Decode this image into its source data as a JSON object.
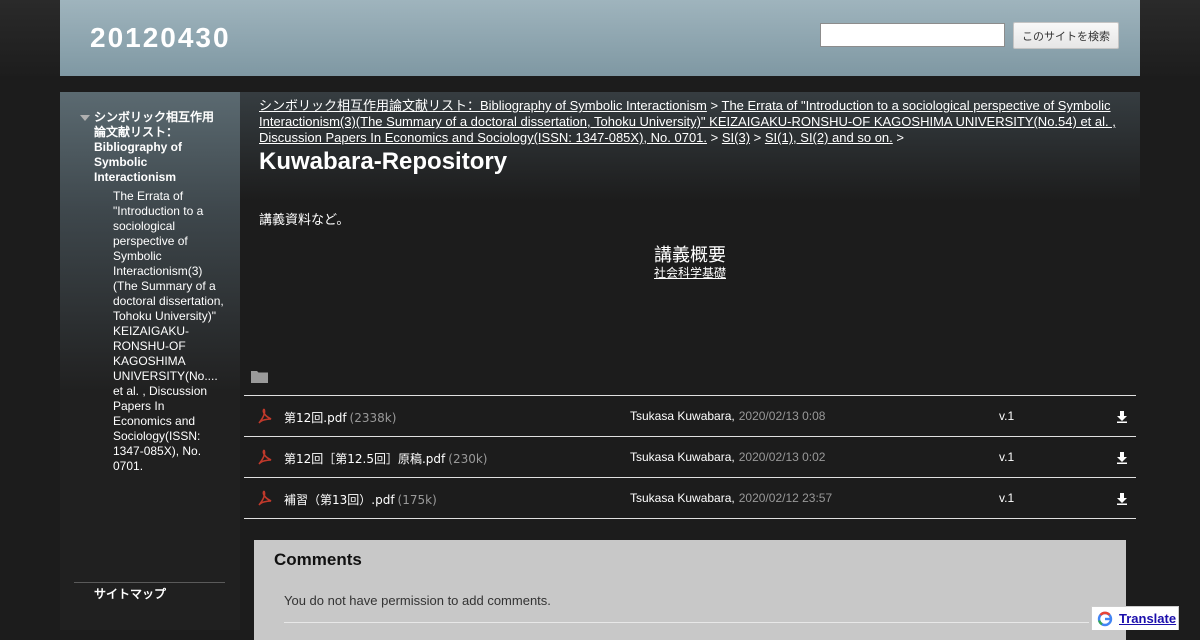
{
  "header": {
    "site_title": "20120430",
    "search_placeholder": "",
    "search_button": "このサイトを検索"
  },
  "sidebar": {
    "main_item": "シンボリック相互作用論文献リスト：Bibliography of Symbolic Interactionism",
    "sub_item": "The Errata of \"Introduction to a sociological perspective of Symbolic Interactionism(3)(The Summary of a doctoral dissertation, Tohoku University)\" KEIZAIGAKU-RONSHU-OF KAGOSHIMA UNIVERSITY(No.... et al. , Discussion Papers In Economics and Sociology(ISSN: 1347-085X), No. 0701.",
    "sitemap": "サイトマップ"
  },
  "breadcrumb": {
    "crumb1": "シンボリック相互作用論文献リスト：Bibliography of Symbolic Interactionism",
    "crumb2": "The Errata of \"Introduction to a sociological perspective of Symbolic Interactionism(3)(The Summary of a doctoral dissertation, Tohoku University)\" KEIZAIGAKU-RONSHU-OF KAGOSHIMA UNIVERSITY(No.54) et al. , Discussion Papers In Economics and Sociology(ISSN: 1347-085X), No. 0701.",
    "crumb3": "SI(3)",
    "crumb4": "SI(1), SI(2) and so on.",
    "separator": ">"
  },
  "page": {
    "title": "Kuwabara-Repository",
    "intro": "講義資料など。",
    "lecture_heading": "講義概要",
    "lecture_link": "社会科学基礎"
  },
  "files": [
    {
      "name": "第12回.pdf",
      "size": "(2338k)",
      "author": "Tsukasa Kuwabara,",
      "date": "2020/02/13 0:08",
      "version": "v.1"
    },
    {
      "name": "第12回［第12.5回］原稿.pdf",
      "size": "(230k)",
      "author": "Tsukasa Kuwabara,",
      "date": "2020/02/13 0:02",
      "version": "v.1"
    },
    {
      "name": "補習（第13回）.pdf",
      "size": "(175k)",
      "author": "Tsukasa Kuwabara,",
      "date": "2020/02/12 23:57",
      "version": "v.1"
    }
  ],
  "comments": {
    "title": "Comments",
    "text": "You do not have permission to add comments."
  },
  "translate": {
    "label": "Translate"
  },
  "colors": {
    "header": "#8fa6b0",
    "background": "#1c1c1c",
    "pdf_icon": "#c0392b"
  }
}
